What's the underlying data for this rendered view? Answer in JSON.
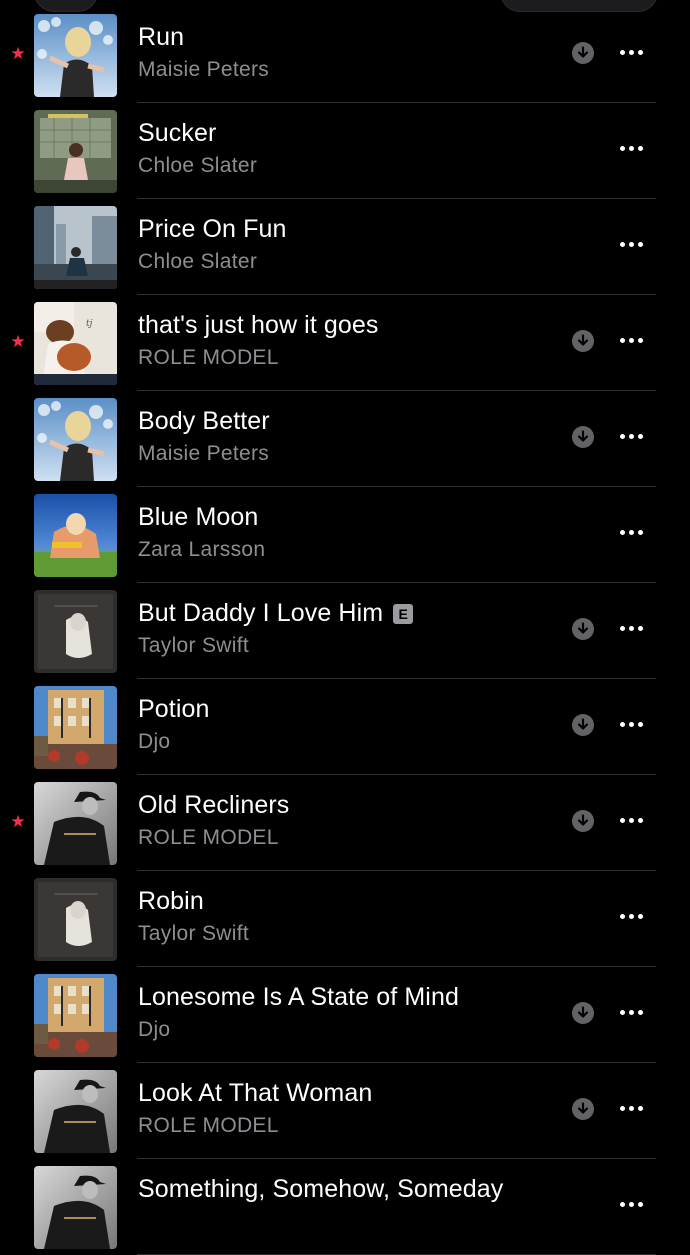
{
  "songs": [
    {
      "title": "Run",
      "artist": "Maisie Peters",
      "favorite": true,
      "downloaded": true,
      "explicit": false,
      "art": "maisie"
    },
    {
      "title": "Sucker",
      "artist": "Chloe Slater",
      "favorite": false,
      "downloaded": false,
      "explicit": false,
      "art": "chloe1"
    },
    {
      "title": "Price On Fun",
      "artist": "Chloe Slater",
      "favorite": false,
      "downloaded": false,
      "explicit": false,
      "art": "chloe2"
    },
    {
      "title": "that's just how it goes",
      "artist": "ROLE MODEL",
      "favorite": true,
      "downloaded": true,
      "explicit": false,
      "art": "rolemodel1"
    },
    {
      "title": "Body Better",
      "artist": "Maisie Peters",
      "favorite": false,
      "downloaded": true,
      "explicit": false,
      "art": "maisie"
    },
    {
      "title": "Blue Moon",
      "artist": "Zara Larsson",
      "favorite": false,
      "downloaded": false,
      "explicit": false,
      "art": "zara"
    },
    {
      "title": "But Daddy I Love Him",
      "artist": "Taylor Swift",
      "favorite": false,
      "downloaded": true,
      "explicit": true,
      "art": "taylor"
    },
    {
      "title": "Potion",
      "artist": "Djo",
      "favorite": false,
      "downloaded": true,
      "explicit": false,
      "art": "djo"
    },
    {
      "title": "Old Recliners",
      "artist": "ROLE MODEL",
      "favorite": true,
      "downloaded": true,
      "explicit": false,
      "art": "rolemodel2"
    },
    {
      "title": "Robin",
      "artist": "Taylor Swift",
      "favorite": false,
      "downloaded": false,
      "explicit": false,
      "art": "taylor"
    },
    {
      "title": "Lonesome Is A State of Mind",
      "artist": "Djo",
      "favorite": false,
      "downloaded": true,
      "explicit": false,
      "art": "djo"
    },
    {
      "title": "Look At That Woman",
      "artist": "ROLE MODEL",
      "favorite": false,
      "downloaded": true,
      "explicit": false,
      "art": "rolemodel2"
    },
    {
      "title": "Something, Somehow, Someday",
      "artist": "",
      "favorite": false,
      "downloaded": false,
      "explicit": false,
      "art": "rolemodel2"
    }
  ],
  "explicit_badge": "E",
  "colors": {
    "favorite_star": "#fa2d48",
    "background": "#000000",
    "secondary_text": "#8e8e93"
  }
}
